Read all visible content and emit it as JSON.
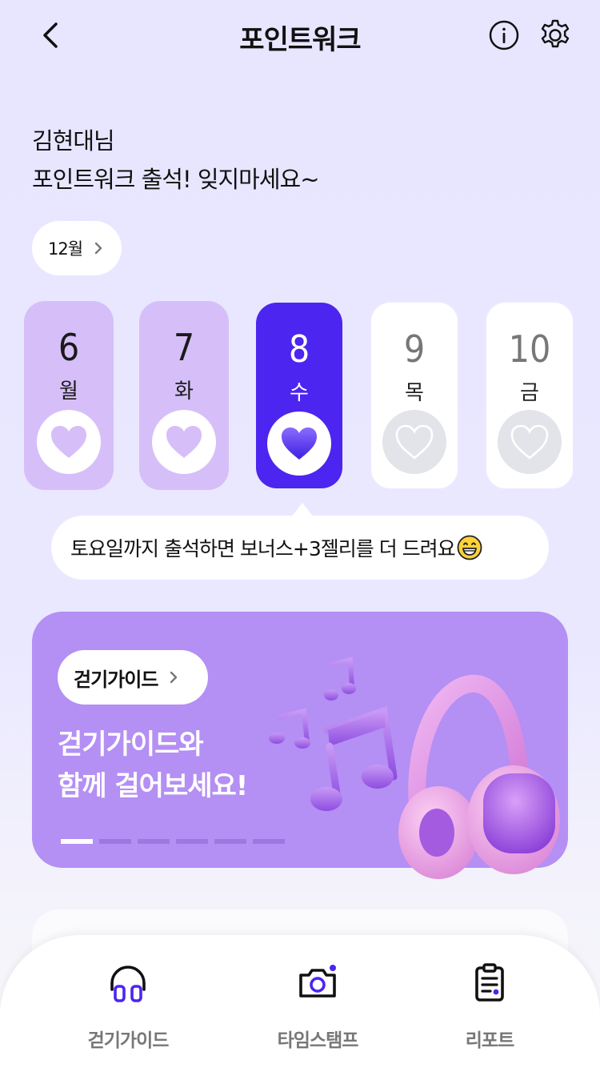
{
  "header": {
    "title": "포인트워크",
    "back_icon": "chevron-left-icon",
    "info_icon": "info-icon",
    "settings_icon": "gear-icon"
  },
  "greeting": {
    "line1": "김현대님",
    "line2": "포인트워크 출석! 잊지마세요~"
  },
  "month": {
    "label": "12월"
  },
  "days": [
    {
      "num": "6",
      "weekday": "월",
      "state": "done"
    },
    {
      "num": "7",
      "weekday": "화",
      "state": "done"
    },
    {
      "num": "8",
      "weekday": "수",
      "state": "today"
    },
    {
      "num": "9",
      "weekday": "목",
      "state": "future"
    },
    {
      "num": "10",
      "weekday": "금",
      "state": "future"
    }
  ],
  "tooltip": {
    "text": "토요일까지 출석하면 보너스+3젤리를 더 드려요"
  },
  "banner": {
    "chip_label": "걷기가이드",
    "title_line1": "걷기가이드와",
    "title_line2": "함께 걸어보세요!",
    "page_count": 6,
    "active_page": 1
  },
  "tabs": [
    {
      "label": "걷기가이드",
      "icon": "headphones-icon"
    },
    {
      "label": "타임스탬프",
      "icon": "camera-icon"
    },
    {
      "label": "리포트",
      "icon": "clipboard-report-icon"
    }
  ],
  "colors": {
    "accent": "#4c25f0",
    "done": "#d6bff8",
    "banner": "#b48ff4",
    "background": "#e8e6ff"
  }
}
